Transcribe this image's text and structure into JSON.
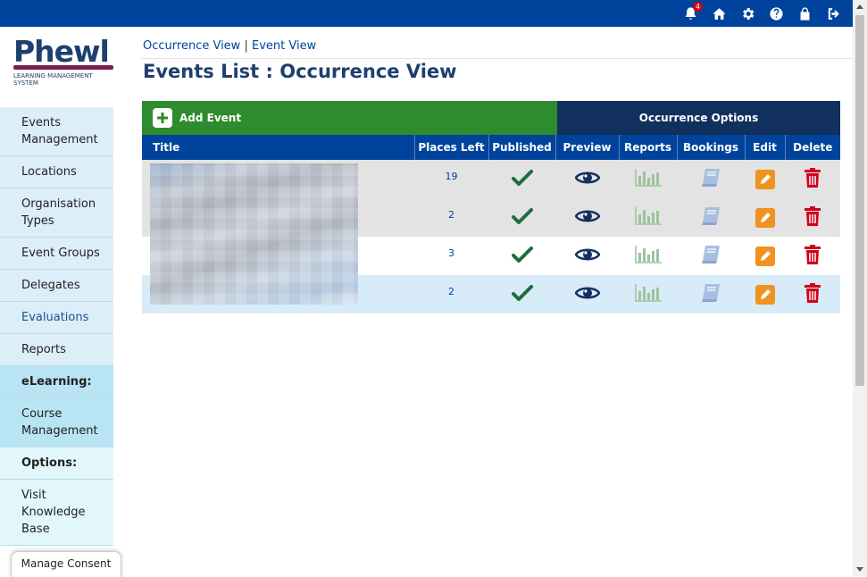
{
  "topbar": {
    "notification_count": "4",
    "icons": [
      "bell-icon",
      "home-icon",
      "gear-icon",
      "help-icon",
      "lock-icon",
      "logout-icon"
    ]
  },
  "logo": {
    "word": "Phewl",
    "subtitle": "LEARNING MANAGEMENT SYSTEM"
  },
  "sidebar": {
    "items": [
      {
        "label": "Events Management"
      },
      {
        "label": "Locations"
      },
      {
        "label": "Organisation Types"
      },
      {
        "label": "Event Groups"
      },
      {
        "label": "Delegates"
      },
      {
        "label": "Evaluations"
      },
      {
        "label": "Reports"
      },
      {
        "label": "eLearning:"
      },
      {
        "label": "Course Management"
      },
      {
        "label": "Options:"
      },
      {
        "label": "Visit Knowledge Base"
      }
    ]
  },
  "consent": {
    "label": "Manage Consent"
  },
  "breadcrumb": {
    "occurrence_view": "Occurrence View",
    "separator": "|",
    "event_view": "Event View"
  },
  "page_title": "Events List : Occurrence View",
  "actions": {
    "add_event": "Add Event",
    "occurrence_options": "Occurrence Options"
  },
  "table": {
    "headers": {
      "title": "Title",
      "places_left": "Places Left",
      "published": "Published",
      "preview": "Preview",
      "reports": "Reports",
      "bookings": "Bookings",
      "edit": "Edit",
      "delete": "Delete"
    },
    "rows": [
      {
        "places_left": "19"
      },
      {
        "places_left": "2"
      },
      {
        "places_left": "3"
      },
      {
        "places_left": "2"
      }
    ]
  },
  "colors": {
    "topbar": "#00439c",
    "add_button": "#2e8b2e",
    "options_button": "#12305e",
    "published_check": "#1f6e3a",
    "edit": "#f0921e",
    "delete": "#d0021b"
  }
}
